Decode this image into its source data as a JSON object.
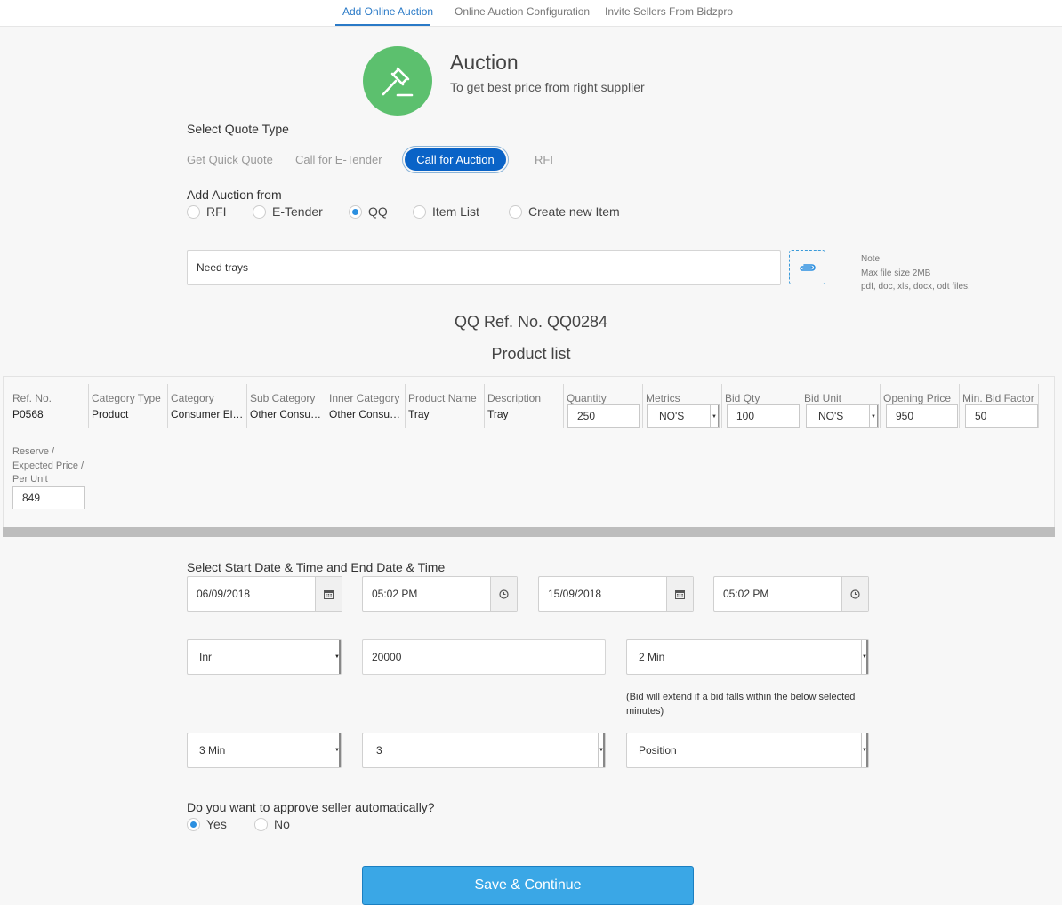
{
  "tabs": [
    {
      "label": "Add Online Auction",
      "active": true
    },
    {
      "label": "Online Auction Configuration",
      "active": false
    },
    {
      "label": "Invite Sellers From Bidzpro",
      "active": false
    }
  ],
  "header": {
    "icon": "gavel-icon",
    "icon_bg": "#5cc06e",
    "title": "Auction",
    "subtitle": "To get best price from right supplier"
  },
  "quote_type": {
    "label": "Select Quote Type",
    "options": [
      "Get Quick Quote",
      "Call for E-Tender",
      "Call for Auction",
      "RFI"
    ],
    "selected": "Call for Auction"
  },
  "auction_from": {
    "label": "Add Auction from",
    "options": [
      "RFI",
      "E-Tender",
      "QQ",
      "Item List",
      "Create new Item"
    ],
    "selected": "QQ"
  },
  "description_input": {
    "value": "Need trays"
  },
  "attachment": {
    "icon": "paperclip-icon",
    "note_lines": [
      "Note:",
      "Max file size 2MB",
      "pdf, doc, xls, docx, odt files."
    ]
  },
  "ref_title": "QQ Ref. No. QQ0284",
  "product_list_title": "Product list",
  "product": {
    "columns": [
      {
        "header": "Ref. No.",
        "value": "P0568"
      },
      {
        "header": "Category Type",
        "value": "Product"
      },
      {
        "header": "Category",
        "value": "Consumer Elec…"
      },
      {
        "header": "Sub Category",
        "value": "Other Consum…"
      },
      {
        "header": "Inner Category",
        "value": "Other Consum…"
      },
      {
        "header": "Product Name",
        "value": "Tray"
      },
      {
        "header": "Description",
        "value": "Tray"
      },
      {
        "header": "Quantity",
        "value": "250"
      },
      {
        "header": "Metrics",
        "value": "NO'S"
      },
      {
        "header": "Bid Qty",
        "value": "100"
      },
      {
        "header": "Bid Unit",
        "value": "NO'S"
      },
      {
        "header": "Opening Price",
        "value": "950"
      },
      {
        "header": "Min. Bid Factor",
        "value": "50"
      }
    ],
    "reserve_label_lines": [
      "Reserve /",
      "Expected Price /",
      "Per Unit"
    ],
    "reserve_value": "849"
  },
  "schedule": {
    "label": "Select Start Date & Time and End Date & Time",
    "start_date": "06/09/2018",
    "start_time": "05:02 PM",
    "end_date": "15/09/2018",
    "end_time": "05:02 PM"
  },
  "settings": {
    "currency": "Inr",
    "amount": "20000",
    "extend_time": "2 Min",
    "bid_extend_note": "(Bid will extend if a bid falls within the below selected minutes)",
    "interval": "3 Min",
    "count": "3",
    "display_mode": "Position"
  },
  "approve": {
    "label": "Do you want to approve seller automatically?",
    "options": [
      "Yes",
      "No"
    ],
    "selected": "Yes"
  },
  "save_button": "Save & Continue"
}
